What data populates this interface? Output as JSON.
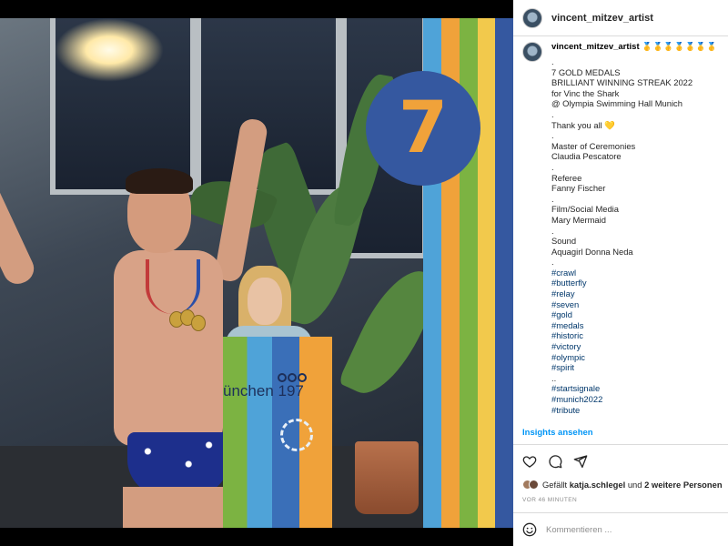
{
  "colors": {
    "link_blue": "#0095f6",
    "hashtag": "#00376b",
    "stripe_colors": [
      "#4fa3d8",
      "#f0a23a",
      "#7cb342",
      "#f2c94c",
      "#3558a0"
    ],
    "badge_bg": "#3558a0",
    "badge_fg": "#f0a23a"
  },
  "photo": {
    "badge_number": "7",
    "flag_text": "ünchen 197",
    "icons": [
      "olympic-rings-icon",
      "olympic-sun-emblem-icon"
    ]
  },
  "header": {
    "username": "vincent_mitzev_artist"
  },
  "caption": {
    "username": "vincent_mitzev_artist",
    "username_suffix": "🥇🥇🥇🥇🥇🥇🥇",
    "lines": [
      {
        "text": ".",
        "type": "text"
      },
      {
        "text": "7 GOLD MEDALS",
        "type": "text"
      },
      {
        "text": "BRILLIANT WINNING STREAK 2022",
        "type": "text"
      },
      {
        "text": "for Vinc the Shark",
        "type": "text"
      },
      {
        "text": "@ Olympia Swimming Hall Munich",
        "type": "text"
      },
      {
        "text": ".",
        "type": "text"
      },
      {
        "text": "Thank you all 💛",
        "type": "text"
      },
      {
        "text": ".",
        "type": "text"
      },
      {
        "text": "Master of Ceremonies",
        "type": "text"
      },
      {
        "text": "Claudia Pescatore",
        "type": "text"
      },
      {
        "text": ".",
        "type": "text"
      },
      {
        "text": "Referee",
        "type": "text"
      },
      {
        "text": "Fanny Fischer",
        "type": "text"
      },
      {
        "text": ".",
        "type": "text"
      },
      {
        "text": "Film/Social Media",
        "type": "text"
      },
      {
        "text": "Mary Mermaid",
        "type": "text"
      },
      {
        "text": ".",
        "type": "text"
      },
      {
        "text": "Sound",
        "type": "text"
      },
      {
        "text": "Aquagirl Donna Neda",
        "type": "text"
      },
      {
        "text": ".",
        "type": "text"
      },
      {
        "text": "#crawl",
        "type": "tag"
      },
      {
        "text": "#butterfly",
        "type": "tag"
      },
      {
        "text": "#relay",
        "type": "tag"
      },
      {
        "text": "#seven",
        "type": "tag"
      },
      {
        "text": "#gold",
        "type": "tag"
      },
      {
        "text": "#medals",
        "type": "tag"
      },
      {
        "text": "#historic",
        "type": "tag"
      },
      {
        "text": "#victory",
        "type": "tag"
      },
      {
        "text": "#olympic",
        "type": "tag"
      },
      {
        "text": "#spirit",
        "type": "tag"
      },
      {
        "text": "..",
        "type": "text"
      },
      {
        "text": "#startsignale",
        "type": "tag"
      },
      {
        "text": "#munich2022",
        "type": "tag"
      },
      {
        "text": "#tribute",
        "type": "tag"
      }
    ]
  },
  "insights_label": "Insights ansehen",
  "actions": {
    "icons": [
      "heart-icon",
      "comment-icon",
      "share-icon"
    ],
    "likes_prefix": "Gefällt",
    "likes_user": "katja.schlegel",
    "likes_mid": "und",
    "likes_others": "2 weitere Personen",
    "timestamp": "VOR 46 MINUTEN"
  },
  "comment": {
    "placeholder": "Kommentieren ..."
  }
}
